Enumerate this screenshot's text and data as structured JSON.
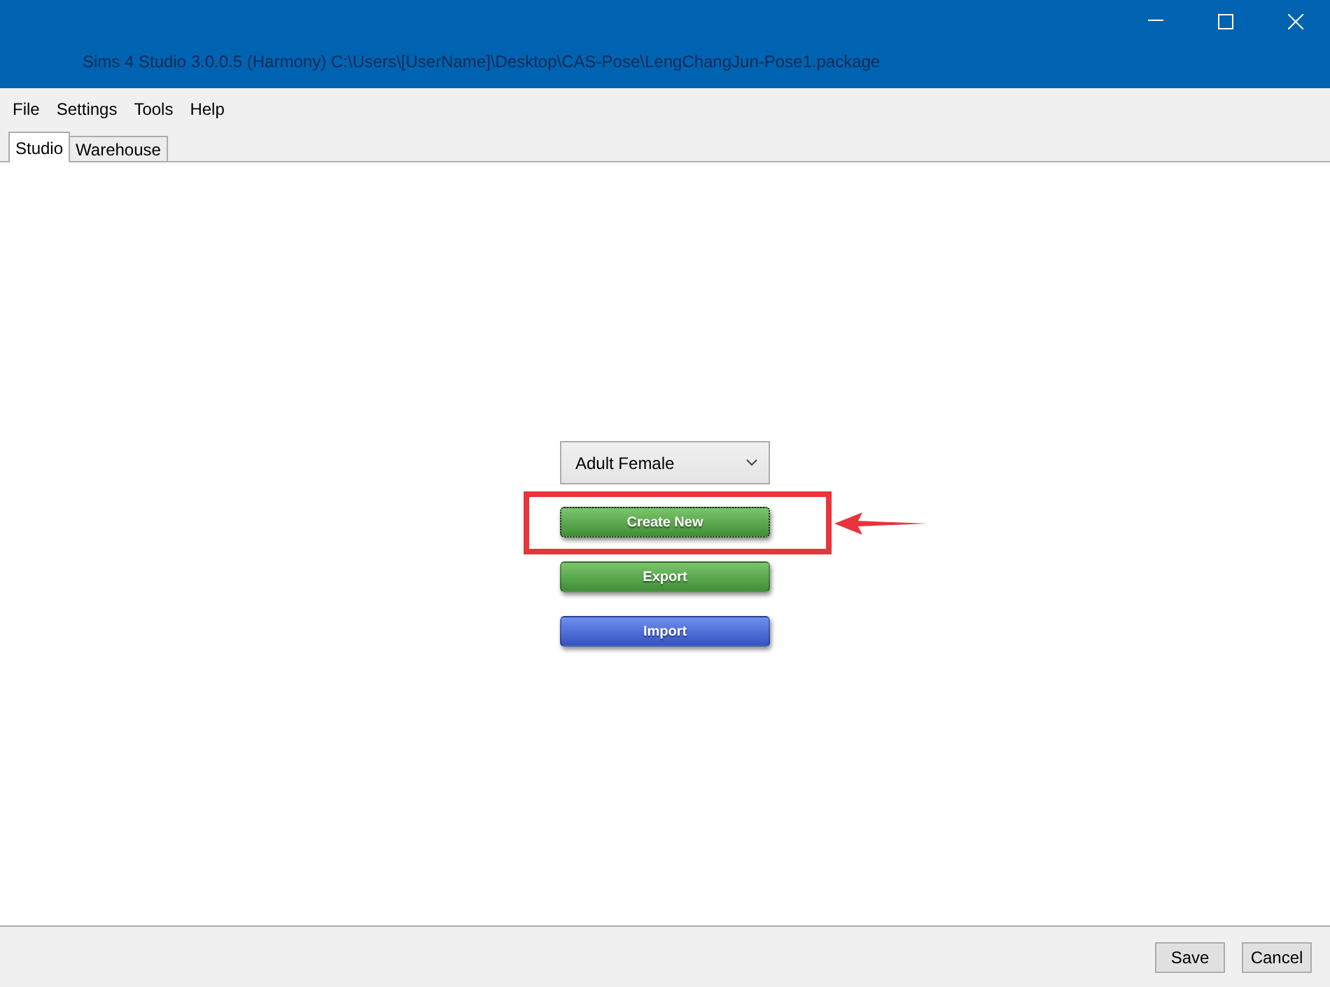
{
  "window": {
    "title": "Sims 4 Studio 3.0.0.5 (Harmony)  C:\\Users\\[UserName]\\Desktop\\CAS-Pose\\LengChangJun-Pose1.package"
  },
  "menu": [
    "File",
    "Settings",
    "Tools",
    "Help"
  ],
  "tabs": [
    {
      "label": "Studio",
      "selected": true
    },
    {
      "label": "Warehouse",
      "selected": false
    }
  ],
  "age_select": {
    "value": "Adult Female"
  },
  "actions": [
    {
      "label": "Create New",
      "kind": "green",
      "focused": true,
      "highlighted": true
    },
    {
      "label": "Export",
      "kind": "green",
      "focused": false,
      "highlighted": false
    },
    {
      "label": "Import",
      "kind": "blue",
      "focused": false,
      "highlighted": false
    }
  ],
  "footer_buttons": [
    "Save",
    "Cancel"
  ]
}
